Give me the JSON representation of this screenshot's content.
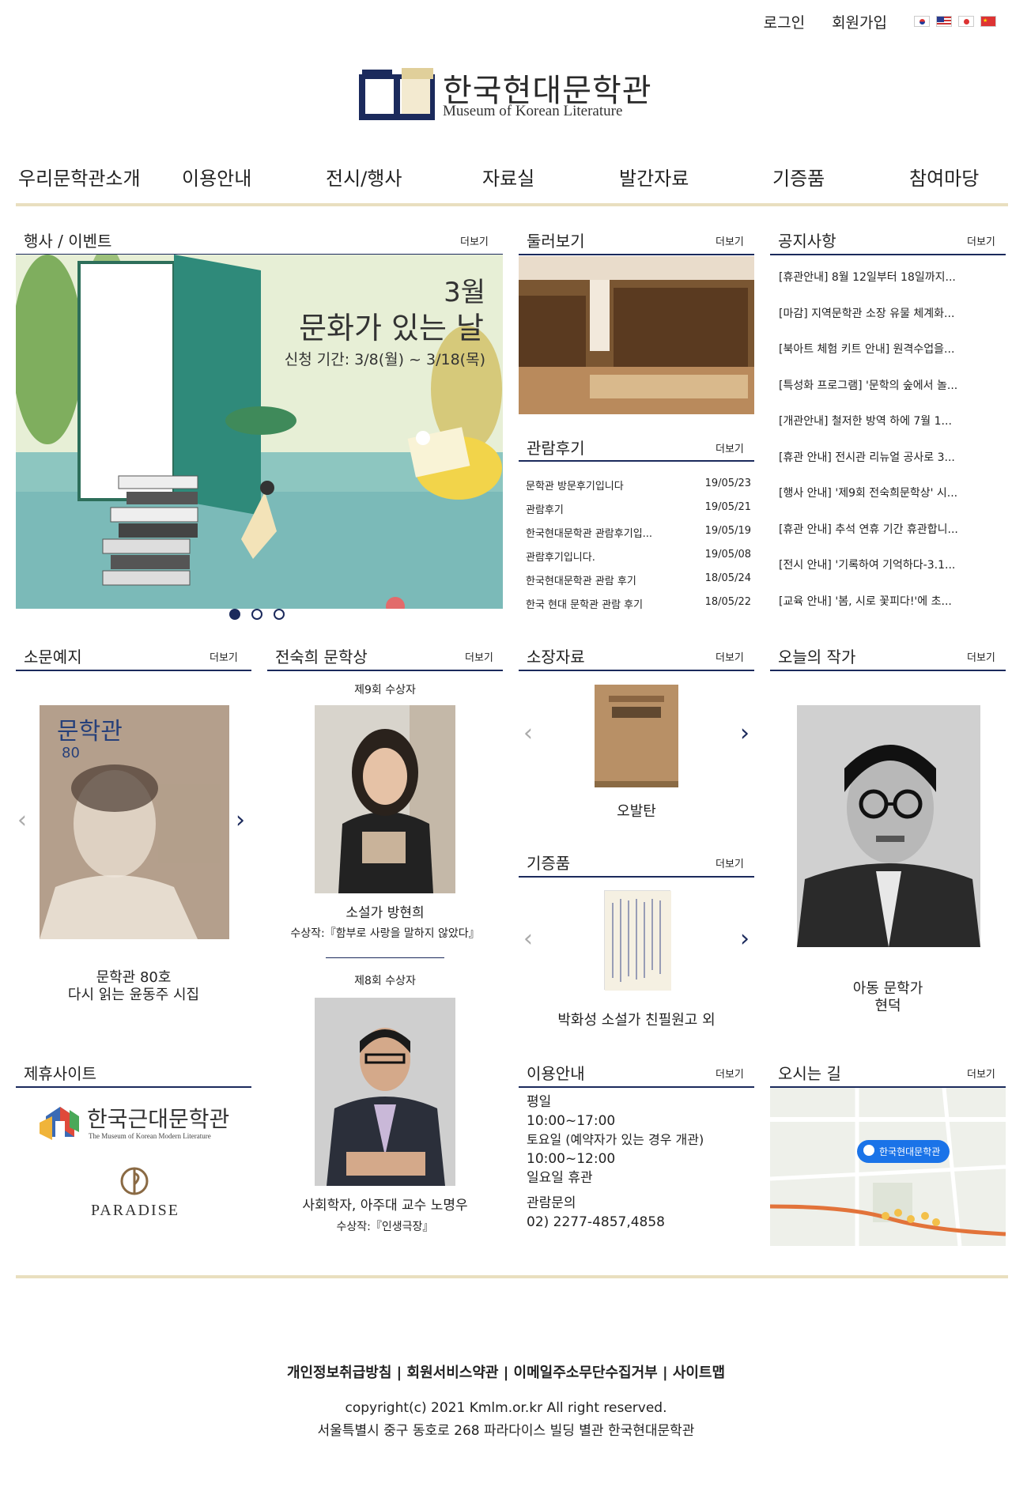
{
  "topbar": {
    "login": "로그인",
    "signup": "회원가입",
    "flags": [
      "korea-flag",
      "usa-flag",
      "japan-flag",
      "china-flag"
    ]
  },
  "logo": {
    "title": "한국현대문학관",
    "subtitle": "Museum of Korean Literature"
  },
  "nav": [
    "우리문학관소개",
    "이용안내",
    "전시/행사",
    "자료실",
    "발간자료",
    "기증품",
    "참여마당"
  ],
  "more": "더보기",
  "events": {
    "title": "행사 / 이벤트",
    "banner_month": "3월",
    "banner_title": "문화가 있는 날",
    "banner_period": "신청 기간: 3/8(월) ~ 3/18(목)"
  },
  "tour": {
    "title": "둘러보기"
  },
  "reviews": {
    "title": "관람후기",
    "items": [
      {
        "title": "문학관 방문후기입니다",
        "date": "19/05/23"
      },
      {
        "title": "관람후기",
        "date": "19/05/21"
      },
      {
        "title": "한국현대문학관 관람후기입...",
        "date": "19/05/19"
      },
      {
        "title": "관람후기입니다.",
        "date": "19/05/08"
      },
      {
        "title": "한국현대문학관 관람 후기",
        "date": "18/05/24"
      },
      {
        "title": "한국 현대 문학관 관람 후기",
        "date": "18/05/22"
      }
    ]
  },
  "notices": {
    "title": "공지사항",
    "items": [
      "[휴관안내] 8월 12일부터 18일까지...",
      "[마감] 지역문학관 소장 유물 체계화...",
      "[북아트 체험 키트 안내] 원격수업을...",
      "[특성화 프로그램] '문학의 숲에서 놀...",
      "[개관안내] 철저한 방역 하에 7월 1...",
      "[휴관 안내] 전시관 리뉴얼 공사로 3...",
      "[행사 안내] '제9회 전숙희문학상' 시...",
      "[휴관 안내] 추석 연휴 기간 휴관합니...",
      "[전시 안내] '기록하여 기억하다-3.1...",
      "[교육 안내] '봄, 시로 꽃피다!'에 초..."
    ]
  },
  "newsletter": {
    "title": "소문예지",
    "cover_title": "문학관",
    "cover_number": "80",
    "caption_line1": "문학관 80호",
    "caption_line2": "다시 읽는 윤동주 시집"
  },
  "award": {
    "title": "전숙희 문학상",
    "winner9_label": "제9회 수상자",
    "winner9_name": "소설가 방현희",
    "winner9_work": "수상작:『함부로 사랑을 말하지 않았다』",
    "winner8_label": "제8회 수상자",
    "winner8_name": "사회학자, 아주대 교수 노명우",
    "winner8_work": "수상작:『인생극장』"
  },
  "collection": {
    "title": "소장자료",
    "caption": "오발탄"
  },
  "donation": {
    "title": "기증품",
    "caption": "박화성 소설가 친필원고 외"
  },
  "writer": {
    "title": "오늘의 작가",
    "caption_line1": "아동 문학가",
    "caption_line2": "현덕"
  },
  "partners": {
    "title": "제휴사이트",
    "partner1_title": "한국근대문학관",
    "partner1_sub": "The Museum of Korean Modern Literature",
    "partner2": "PARADISE"
  },
  "usage": {
    "title": "이용안내",
    "lines": [
      "평일",
      "10:00~17:00",
      "토요일 (예약자가 있는 경우 개관)",
      "10:00~12:00",
      "일요일 휴관"
    ],
    "contact_label": "관람문의",
    "contact_phone": "02) 2277-4857,4858"
  },
  "directions": {
    "title": "오시는 길",
    "map_label": "한국현대문학관"
  },
  "footer": {
    "links": "개인정보취급방침 | 회원서비스약관 | 이메일주소무단수집거부 | 사이트맵",
    "copyright": "copyright(c) 2021 Kmlm.or.kr All right reserved.",
    "address": "서울특별시 중구 동호로 268 파라다이스 빌딩 별관 한국현대문학관"
  },
  "colors": {
    "navy": "#1b2a5c",
    "gold": "#e9dfbf",
    "text": "#222222"
  }
}
